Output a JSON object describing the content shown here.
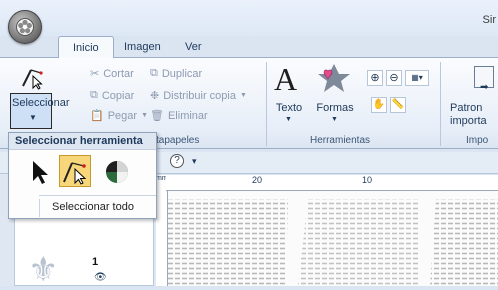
{
  "window": {
    "title": "Sir"
  },
  "tabs": [
    "Inicio",
    "Imagen",
    "Ver"
  ],
  "ribbon": {
    "select_button_label": "Seleccionar",
    "clipboard": {
      "cut": "Cortar",
      "copy": "Copiar",
      "paste": "Pegar",
      "duplicate": "Duplicar",
      "distribute_copy": "Distribuir copia",
      "delete": "Eliminar",
      "group_label": "tapapeles"
    },
    "tools": {
      "text": "Texto",
      "shapes": "Formas",
      "group_label": "Herramientas"
    },
    "import": {
      "label_line1": "Patron",
      "label_line2": "importa",
      "group_label": "Impo"
    }
  },
  "dropdown": {
    "header": "Seleccionar herramienta",
    "select_all": "Seleccionar todo"
  },
  "document": {
    "ruler_unit": "mm",
    "ruler_ticks": [
      "20",
      "10"
    ],
    "layer_number": "1"
  }
}
